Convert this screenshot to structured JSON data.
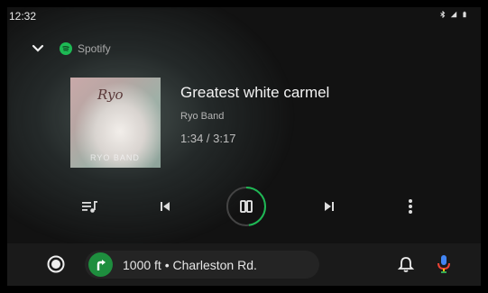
{
  "status_bar": {
    "time": "12:32"
  },
  "header": {
    "app_name": "Spotify",
    "app_icon": "spotify-logo",
    "collapse_icon": "chevron-down-icon"
  },
  "now_playing": {
    "title": "Greatest white carmel",
    "artist": "Ryo Band",
    "time": "1:34 / 3:17",
    "progress": 0.477,
    "album_art_text": "Ryo",
    "album_art_subtext": "RYO BAND"
  },
  "controls": [
    {
      "icon": "queue-icon"
    },
    {
      "icon": "skip-previous-icon"
    },
    {
      "icon": "pause-icon"
    },
    {
      "icon": "skip-next-icon"
    },
    {
      "icon": "more-vert-icon"
    }
  ],
  "bottom_bar": {
    "navigation_text": "1000 ft • Charleston Rd.",
    "home_icon": "home-circle-icon",
    "turn_icon": "turn-right-icon",
    "bell_icon": "bell-icon",
    "mic_icon": "mic-icon"
  },
  "colors": {
    "spotify_green": "#1db954",
    "nav_green": "#1e8e3e",
    "mic_blue": "#4285f4",
    "mic_red": "#ea4335",
    "mic_yellow": "#fbbc04"
  }
}
